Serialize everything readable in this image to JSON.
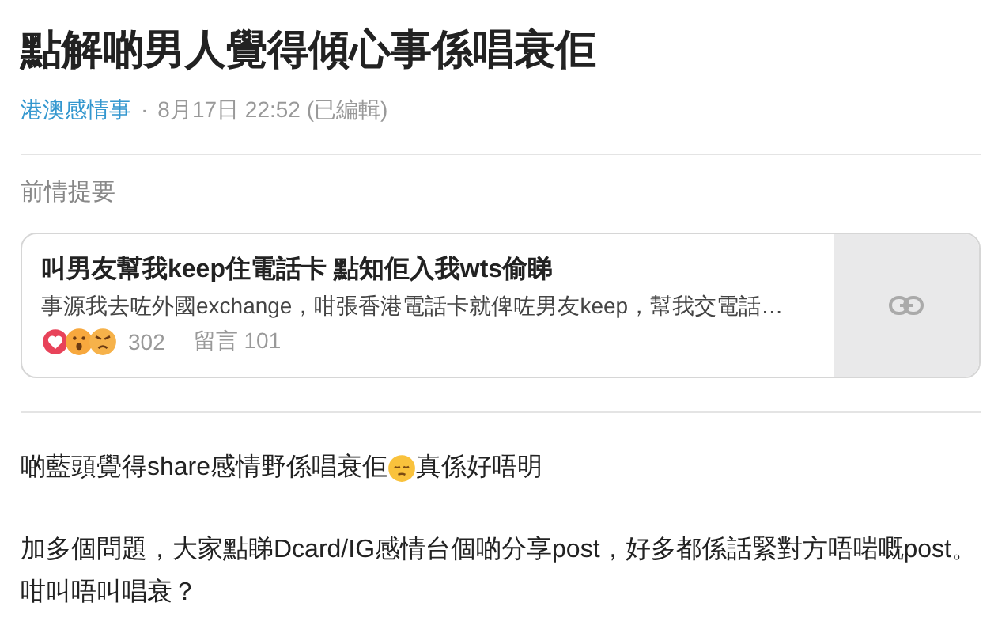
{
  "title": "點解啲男人覺得傾心事係唱衰佢",
  "meta": {
    "board": "港澳感情事",
    "separator": "·",
    "time": "8月17日 22:52 (已編輯)"
  },
  "section_label": "前情提要",
  "linked_post": {
    "title": "叫男友幫我keep住電話卡 點知佢入我wts偷睇",
    "excerpt": "事源我去咗外國exchange，咁張香港電話卡就俾咗男友keep，幫我交電話…",
    "reactions": [
      {
        "kind": "heart"
      },
      {
        "kind": "surprised"
      },
      {
        "kind": "angry"
      }
    ],
    "likes": "302",
    "comments": "留言 101"
  },
  "paragraphs": [
    {
      "parts": [
        {
          "kind": "text",
          "text": "啲藍頭覺得share感情野係唱衰佢"
        },
        {
          "kind": "emoji"
        },
        {
          "kind": "text",
          "text": "真係好唔明"
        }
      ]
    },
    {
      "text": "加多個問題，大家點睇Dcard/IG感情台個啲分享post，好多都係話緊對方唔啱嘅post。咁叫唔叫唱衰？"
    }
  ]
}
